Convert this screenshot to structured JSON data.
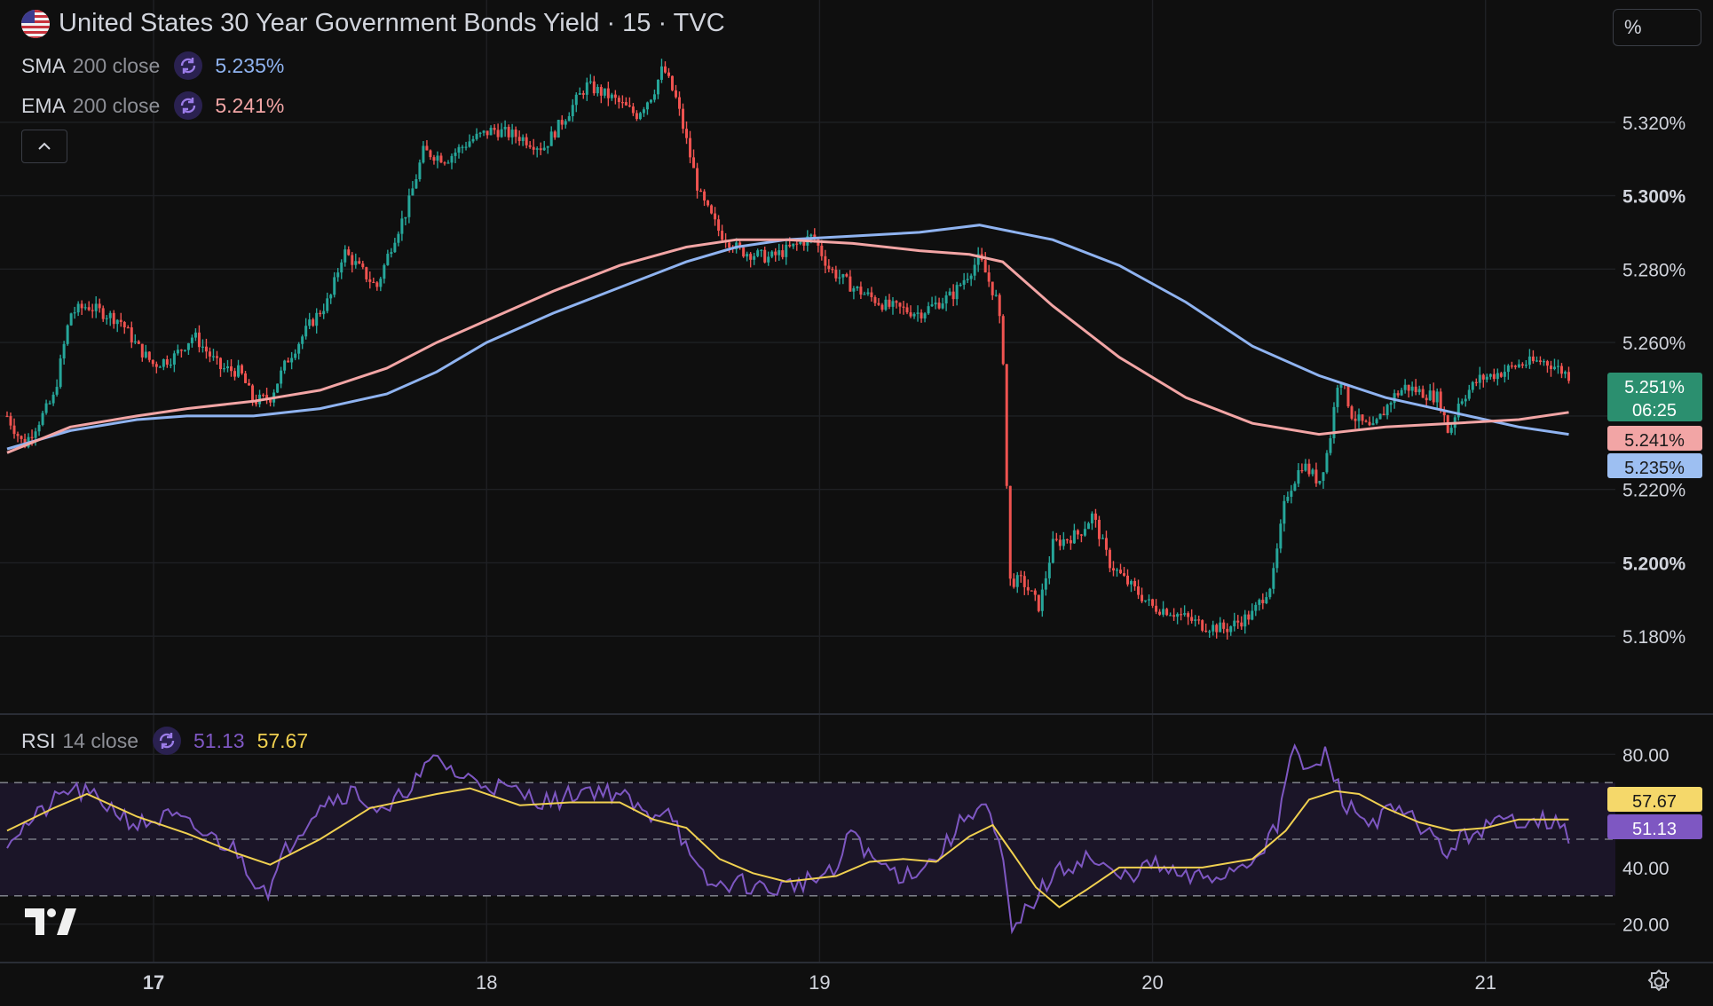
{
  "header": {
    "title": "United States 30 Year Government Bonds Yield · 15 · TVC",
    "scale_label": "%"
  },
  "indicators": {
    "sma": {
      "name": "SMA",
      "params": "200 close",
      "value": "5.235%",
      "color": "#8fb3f0"
    },
    "ema": {
      "name": "EMA",
      "params": "200 close",
      "value": "5.241%",
      "color": "#f2a5a5"
    },
    "rsi": {
      "name": "RSI",
      "params": "14 close",
      "value": "51.13",
      "ma_value": "57.67",
      "color": "#7e57c2",
      "ma_color": "#f0d050"
    }
  },
  "price_tags": {
    "last": {
      "price": "5.251%",
      "countdown": "06:25",
      "color": "#2b8f6f"
    },
    "ema": {
      "price": "5.241%",
      "color": "#f2a5a5"
    },
    "sma": {
      "price": "5.235%",
      "color": "#9dbff2"
    },
    "rsi_ma": {
      "value": "57.67",
      "color": "#f5d86a"
    },
    "rsi": {
      "value": "51.13",
      "color": "#7e57c2"
    }
  },
  "colors": {
    "up": "#26a69a",
    "down": "#ef5350",
    "background": "#0f0f0f",
    "grid": "#1f2024"
  },
  "chart_data": [
    {
      "type": "candlestick",
      "title": "United States 30 Year Government Bonds Yield · 15 · TVC",
      "ylim": [
        5.16,
        5.34
      ],
      "y_ticks": [
        "5.320%",
        "5.300%",
        "5.280%",
        "5.260%",
        "5.240%",
        "5.220%",
        "5.200%",
        "5.180%"
      ],
      "y_tick_values": [
        5.32,
        5.3,
        5.28,
        5.26,
        5.24,
        5.22,
        5.2,
        5.18
      ],
      "x_ticks": [
        "17",
        "18",
        "19",
        "20",
        "21"
      ],
      "x_tick_days": [
        17,
        18,
        19,
        20,
        21
      ],
      "xlim_days": [
        16.56,
        21.27
      ],
      "close_path": [
        [
          16.56,
          5.24
        ],
        [
          16.61,
          5.232
        ],
        [
          16.7,
          5.245
        ],
        [
          16.75,
          5.268
        ],
        [
          16.8,
          5.27
        ],
        [
          16.9,
          5.266
        ],
        [
          16.95,
          5.259
        ],
        [
          17.0,
          5.254
        ],
        [
          17.06,
          5.256
        ],
        [
          17.12,
          5.262
        ],
        [
          17.2,
          5.253
        ],
        [
          17.26,
          5.252
        ],
        [
          17.3,
          5.244
        ],
        [
          17.35,
          5.245
        ],
        [
          17.4,
          5.255
        ],
        [
          17.47,
          5.265
        ],
        [
          17.53,
          5.272
        ],
        [
          17.57,
          5.285
        ],
        [
          17.62,
          5.28
        ],
        [
          17.67,
          5.275
        ],
        [
          17.72,
          5.288
        ],
        [
          17.76,
          5.296
        ],
        [
          17.81,
          5.312
        ],
        [
          17.88,
          5.31
        ],
        [
          17.95,
          5.315
        ],
        [
          18.02,
          5.318
        ],
        [
          18.1,
          5.316
        ],
        [
          18.17,
          5.313
        ],
        [
          18.24,
          5.322
        ],
        [
          18.3,
          5.33
        ],
        [
          18.37,
          5.327
        ],
        [
          18.45,
          5.322
        ],
        [
          18.5,
          5.328
        ],
        [
          18.53,
          5.335
        ],
        [
          18.57,
          5.326
        ],
        [
          18.6,
          5.315
        ],
        [
          18.64,
          5.3
        ],
        [
          18.7,
          5.29
        ],
        [
          18.76,
          5.285
        ],
        [
          18.85,
          5.283
        ],
        [
          18.92,
          5.286
        ],
        [
          18.98,
          5.289
        ],
        [
          19.03,
          5.28
        ],
        [
          19.1,
          5.275
        ],
        [
          19.2,
          5.27
        ],
        [
          19.3,
          5.268
        ],
        [
          19.4,
          5.273
        ],
        [
          19.48,
          5.283
        ],
        [
          19.53,
          5.272
        ],
        [
          19.55,
          5.26
        ],
        [
          19.57,
          5.195
        ],
        [
          19.61,
          5.195
        ],
        [
          19.66,
          5.188
        ],
        [
          19.7,
          5.205
        ],
        [
          19.78,
          5.208
        ],
        [
          19.82,
          5.213
        ],
        [
          19.87,
          5.2
        ],
        [
          19.92,
          5.195
        ],
        [
          20.0,
          5.188
        ],
        [
          20.05,
          5.187
        ],
        [
          20.15,
          5.183
        ],
        [
          20.22,
          5.182
        ],
        [
          20.3,
          5.186
        ],
        [
          20.36,
          5.195
        ],
        [
          20.4,
          5.218
        ],
        [
          20.45,
          5.227
        ],
        [
          20.5,
          5.222
        ],
        [
          20.53,
          5.232
        ],
        [
          20.56,
          5.252
        ],
        [
          20.6,
          5.24
        ],
        [
          20.66,
          5.236
        ],
        [
          20.72,
          5.245
        ],
        [
          20.76,
          5.248
        ],
        [
          20.82,
          5.246
        ],
        [
          20.86,
          5.245
        ],
        [
          20.89,
          5.235
        ],
        [
          20.92,
          5.244
        ],
        [
          20.98,
          5.25
        ],
        [
          21.05,
          5.252
        ],
        [
          21.1,
          5.254
        ],
        [
          21.17,
          5.255
        ],
        [
          21.2,
          5.254
        ],
        [
          21.25,
          5.251
        ]
      ],
      "series": [
        {
          "name": "SMA",
          "color": "#8fb3f0",
          "points": [
            [
              16.56,
              5.231
            ],
            [
              16.75,
              5.236
            ],
            [
              16.95,
              5.239
            ],
            [
              17.1,
              5.24
            ],
            [
              17.3,
              5.24
            ],
            [
              17.5,
              5.242
            ],
            [
              17.7,
              5.246
            ],
            [
              17.85,
              5.252
            ],
            [
              18.0,
              5.26
            ],
            [
              18.2,
              5.268
            ],
            [
              18.4,
              5.275
            ],
            [
              18.6,
              5.282
            ],
            [
              18.75,
              5.286
            ],
            [
              18.9,
              5.288
            ],
            [
              19.1,
              5.289
            ],
            [
              19.3,
              5.29
            ],
            [
              19.48,
              5.292
            ],
            [
              19.7,
              5.288
            ],
            [
              19.9,
              5.281
            ],
            [
              20.1,
              5.271
            ],
            [
              20.3,
              5.259
            ],
            [
              20.5,
              5.251
            ],
            [
              20.7,
              5.245
            ],
            [
              20.9,
              5.241
            ],
            [
              21.1,
              5.237
            ],
            [
              21.25,
              5.235
            ]
          ]
        },
        {
          "name": "EMA",
          "color": "#f2a5a5",
          "points": [
            [
              16.56,
              5.23
            ],
            [
              16.75,
              5.237
            ],
            [
              16.95,
              5.24
            ],
            [
              17.1,
              5.242
            ],
            [
              17.3,
              5.244
            ],
            [
              17.5,
              5.247
            ],
            [
              17.7,
              5.253
            ],
            [
              17.85,
              5.26
            ],
            [
              18.0,
              5.266
            ],
            [
              18.2,
              5.274
            ],
            [
              18.4,
              5.281
            ],
            [
              18.6,
              5.286
            ],
            [
              18.75,
              5.288
            ],
            [
              18.9,
              5.288
            ],
            [
              19.1,
              5.287
            ],
            [
              19.3,
              5.285
            ],
            [
              19.45,
              5.284
            ],
            [
              19.55,
              5.282
            ],
            [
              19.7,
              5.27
            ],
            [
              19.9,
              5.256
            ],
            [
              20.1,
              5.245
            ],
            [
              20.3,
              5.238
            ],
            [
              20.5,
              5.235
            ],
            [
              20.7,
              5.237
            ],
            [
              20.9,
              5.238
            ],
            [
              21.1,
              5.239
            ],
            [
              21.25,
              5.241
            ]
          ]
        }
      ]
    },
    {
      "type": "line",
      "title": "RSI 14 close",
      "ylim": [
        8,
        92
      ],
      "y_ticks": [
        "80.00",
        "40.00",
        "20.00"
      ],
      "y_tick_values": [
        80,
        40,
        20
      ],
      "bands": [
        70,
        50,
        30
      ],
      "series": [
        {
          "name": "RSI",
          "color": "#7e57c2",
          "points": [
            [
              16.56,
              50
            ],
            [
              16.65,
              58
            ],
            [
              16.75,
              68
            ],
            [
              16.85,
              63
            ],
            [
              16.95,
              55
            ],
            [
              17.05,
              58
            ],
            [
              17.15,
              52
            ],
            [
              17.25,
              46
            ],
            [
              17.3,
              36
            ],
            [
              17.35,
              32
            ],
            [
              17.4,
              47
            ],
            [
              17.5,
              63
            ],
            [
              17.6,
              67
            ],
            [
              17.7,
              58
            ],
            [
              17.75,
              67
            ],
            [
              17.8,
              72
            ],
            [
              17.85,
              79
            ],
            [
              17.92,
              72
            ],
            [
              18.0,
              70
            ],
            [
              18.1,
              66
            ],
            [
              18.2,
              63
            ],
            [
              18.3,
              68
            ],
            [
              18.4,
              66
            ],
            [
              18.48,
              58
            ],
            [
              18.55,
              62
            ],
            [
              18.62,
              40
            ],
            [
              18.68,
              33
            ],
            [
              18.75,
              35
            ],
            [
              18.85,
              32
            ],
            [
              18.95,
              35
            ],
            [
              19.05,
              38
            ],
            [
              19.1,
              55
            ],
            [
              19.15,
              43
            ],
            [
              19.25,
              37
            ],
            [
              19.35,
              43
            ],
            [
              19.45,
              60
            ],
            [
              19.5,
              62
            ],
            [
              19.55,
              42
            ],
            [
              19.58,
              15
            ],
            [
              19.62,
              25
            ],
            [
              19.7,
              37
            ],
            [
              19.8,
              44
            ],
            [
              19.9,
              36
            ],
            [
              20.0,
              41
            ],
            [
              20.1,
              36
            ],
            [
              20.2,
              37
            ],
            [
              20.3,
              43
            ],
            [
              20.38,
              55
            ],
            [
              20.42,
              85
            ],
            [
              20.46,
              72
            ],
            [
              20.52,
              80
            ],
            [
              20.58,
              62
            ],
            [
              20.65,
              56
            ],
            [
              20.72,
              60
            ],
            [
              20.8,
              56
            ],
            [
              20.88,
              45
            ],
            [
              20.95,
              52
            ],
            [
              21.05,
              56
            ],
            [
              21.15,
              58
            ],
            [
              21.2,
              56
            ],
            [
              21.25,
              51
            ]
          ]
        },
        {
          "name": "RSI MA",
          "color": "#f0d050",
          "points": [
            [
              16.56,
              53
            ],
            [
              16.7,
              61
            ],
            [
              16.8,
              66
            ],
            [
              16.95,
              58
            ],
            [
              17.1,
              52
            ],
            [
              17.25,
              45
            ],
            [
              17.35,
              41
            ],
            [
              17.5,
              50
            ],
            [
              17.65,
              61
            ],
            [
              17.85,
              66
            ],
            [
              17.95,
              68
            ],
            [
              18.1,
              62
            ],
            [
              18.25,
              63
            ],
            [
              18.4,
              63
            ],
            [
              18.5,
              57
            ],
            [
              18.6,
              54
            ],
            [
              18.7,
              43
            ],
            [
              18.8,
              38
            ],
            [
              18.9,
              35
            ],
            [
              19.05,
              37
            ],
            [
              19.15,
              42
            ],
            [
              19.25,
              43
            ],
            [
              19.35,
              42
            ],
            [
              19.45,
              51
            ],
            [
              19.52,
              55
            ],
            [
              19.58,
              45
            ],
            [
              19.65,
              33
            ],
            [
              19.72,
              26
            ],
            [
              19.8,
              32
            ],
            [
              19.9,
              40
            ],
            [
              20.0,
              40
            ],
            [
              20.15,
              40
            ],
            [
              20.3,
              43
            ],
            [
              20.4,
              53
            ],
            [
              20.47,
              64
            ],
            [
              20.55,
              67
            ],
            [
              20.62,
              66
            ],
            [
              20.7,
              61
            ],
            [
              20.8,
              56
            ],
            [
              20.9,
              53
            ],
            [
              21.0,
              54
            ],
            [
              21.1,
              57
            ],
            [
              21.25,
              57
            ]
          ]
        }
      ]
    }
  ]
}
